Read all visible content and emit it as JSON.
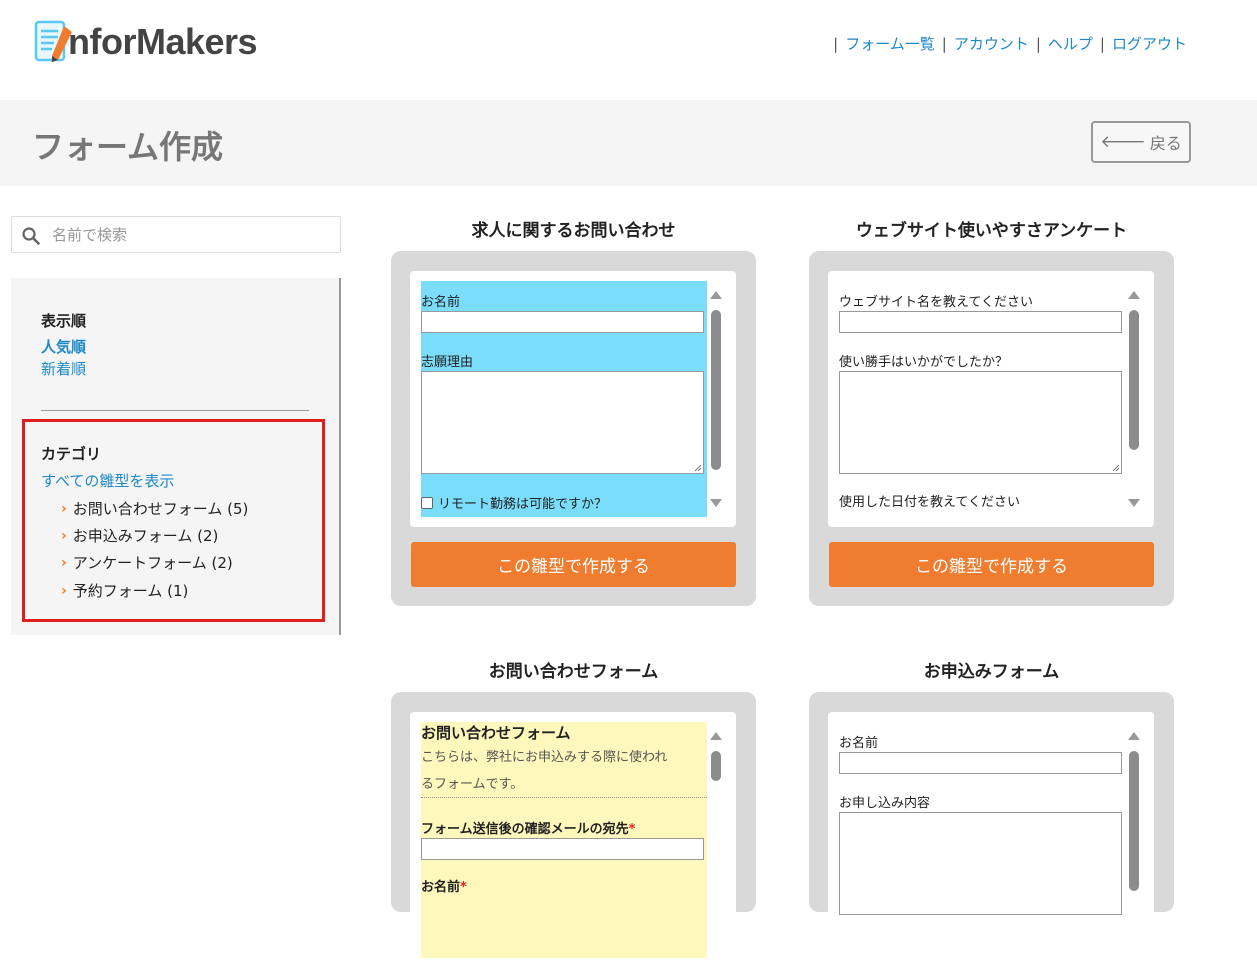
{
  "brand": {
    "logo_text": "nforMakers",
    "logo_mark": "i"
  },
  "topnav": {
    "items": [
      "フォーム一覧",
      "アカウント",
      "ヘルプ",
      "ログアウト"
    ],
    "separator": "|"
  },
  "page": {
    "title": "フォーム作成",
    "back_label": "戻る"
  },
  "search": {
    "placeholder": "名前で検索",
    "value": ""
  },
  "sidebar": {
    "sort_heading": "表示順",
    "sort_options": [
      "人気順",
      "新着順"
    ],
    "sort_active": "人気順",
    "category_heading": "カテゴリ",
    "show_all_label": "すべての雛型を表示",
    "categories": [
      {
        "label": "お問い合わせフォーム (5)"
      },
      {
        "label": "お申込みフォーム (2)"
      },
      {
        "label": "アンケートフォーム (2)"
      },
      {
        "label": "予約フォーム (1)"
      }
    ]
  },
  "templates": [
    {
      "title": "求人に関するお問い合わせ",
      "fields": [
        "お名前",
        "志願理由"
      ],
      "checkbox_label": "リモート勤務は可能ですか？",
      "button_label": "この雛型で作成する"
    },
    {
      "title": "ウェブサイト使いやすさアンケート",
      "fields": [
        "ウェブサイト名を教えてください",
        "使い勝手はいかがでしたか？",
        "使用した日付を教えてください"
      ],
      "button_label": "この雛型で作成する"
    },
    {
      "title": "お問い合わせフォーム",
      "heading": "お問い合わせフォーム",
      "description_line1": "こちらは、弊社にお申込みする際に使われ",
      "description_line2": "るフォームです。",
      "fields": [
        "フォーム送信後の確認メールの宛先",
        "お名前"
      ],
      "required_mark": "*"
    },
    {
      "title": "お申込みフォーム",
      "fields": [
        "お名前",
        "お申し込み内容"
      ]
    }
  ],
  "colors": {
    "accent": "#f07c2f",
    "link": "#1e88c8",
    "highlight": "#e02020"
  }
}
